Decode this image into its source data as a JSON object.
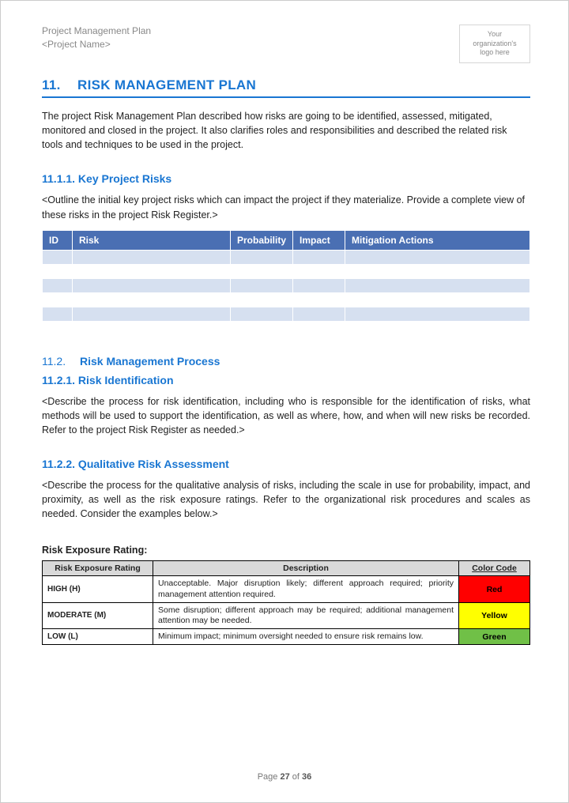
{
  "header": {
    "doc_title": "Project Management Plan",
    "project_name": "<Project Name>",
    "logo_text": "Your organization's logo here"
  },
  "section": {
    "number": "11.",
    "title": "RISK MANAGEMENT PLAN",
    "intro": "The project Risk Management Plan described how risks are going to be identified, assessed, mitigated, monitored and closed in the project. It also clarifies roles and responsibilities and described the related risk tools and techniques to be used in the project."
  },
  "s1": {
    "heading": "11.1.1. Key Project Risks",
    "note": "<Outline the initial key project risks which can impact the project if they materialize. Provide a complete view of these risks in the project Risk Register.>",
    "cols": {
      "id": "ID",
      "risk": "Risk",
      "prob": "Probability",
      "impact": "Impact",
      "mit": "Mitigation Actions"
    }
  },
  "s2": {
    "num": "11.2.",
    "title": "Risk Management Process"
  },
  "s21": {
    "heading": "11.2.1. Risk Identification",
    "text": "<Describe the process for risk identification, including who is responsible for the identification of risks, what methods will be used to support the identification, as well as where, how, and when will new risks be recorded. Refer to the project Risk Register as needed.>"
  },
  "s22": {
    "heading": "11.2.2. Qualitative Risk Assessment",
    "text": "<Describe the process for the qualitative analysis of risks, including the scale in use for probability, impact, and proximity, as well as the risk exposure ratings. Refer to the organizational risk procedures and scales as needed. Consider the examples below.>"
  },
  "rating": {
    "title": "Risk Exposure Rating:",
    "headers": {
      "r": "Risk Exposure Rating",
      "d": "Description",
      "c": "Color Code"
    },
    "rows": [
      {
        "label": "HIGH (H)",
        "desc": "Unacceptable. Major disruption likely; different approach required; priority management attention required.",
        "code": "Red",
        "cls": "red"
      },
      {
        "label": "MODERATE (M)",
        "desc": "Some disruption; different approach may be required; additional management attention may be needed.",
        "code": "Yellow",
        "cls": "yellow"
      },
      {
        "label": "LOW (L)",
        "desc": "Minimum impact; minimum oversight needed to ensure risk remains low.",
        "code": "Green",
        "cls": "green"
      }
    ]
  },
  "footer": {
    "prefix": "Page ",
    "page": "27",
    "mid": " of ",
    "total": "36"
  }
}
